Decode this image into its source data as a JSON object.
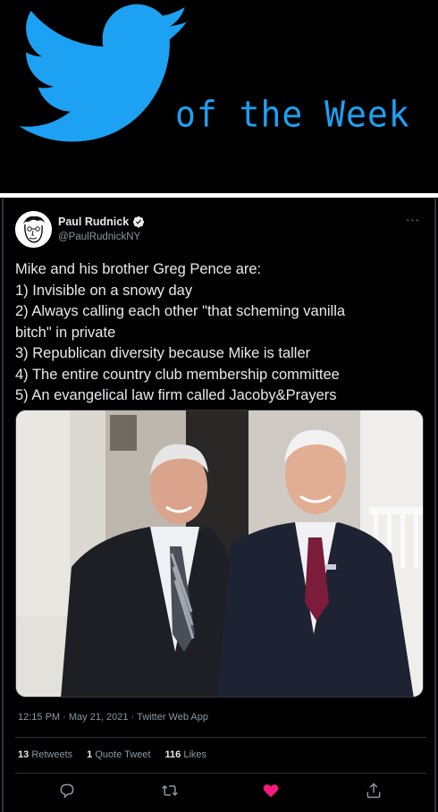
{
  "banner": {
    "icon": "twitter-bird-icon",
    "caption": "of the Week",
    "color": "#1da1f2"
  },
  "tweet": {
    "author": {
      "name": "Paul Rudnick",
      "handle": "@PaulRudnickNY",
      "verified": true
    },
    "more_icon": "more-options-icon",
    "lines": [
      "Mike and his brother Greg Pence are:",
      "1) Invisible on a snowy day",
      "2) Always calling each other \"that scheming vanilla",
      "bitch\" in private",
      "3) Republican diversity because Mike is taller",
      "4) The entire country club membership committee",
      "5) An evangelical law firm called Jacoby&Prayers"
    ],
    "timestamp": "12:15 PM · May 21, 2021 · Twitter Web App",
    "stats": {
      "retweets_count": "13",
      "retweets_label": "Retweets",
      "quotes_count": "1",
      "quotes_label": "Quote Tweet",
      "likes_count": "116",
      "likes_label": "Likes"
    },
    "actions": [
      "reply-icon",
      "retweet-icon",
      "like-icon",
      "share-icon"
    ],
    "like_color": "#f91880"
  }
}
